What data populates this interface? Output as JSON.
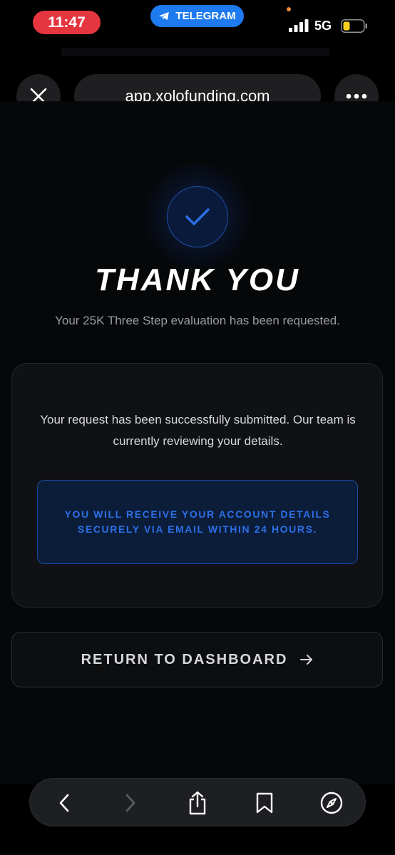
{
  "status_bar": {
    "time": "11:47",
    "back_app": "TELEGRAM",
    "network": "5G",
    "accent_time": "#e5353f",
    "accent_telegram": "#1e7bef",
    "icons": [
      "telegram-icon",
      "signal-icon",
      "battery-icon"
    ]
  },
  "browser": {
    "url": "app.xolofunding.com",
    "icons": [
      "close-icon",
      "more-icon"
    ]
  },
  "page": {
    "title": "THANK YOU",
    "subtitle": "Your 25K Three Step evaluation has been requested.",
    "card_text": "Your request has been successfully submitted. Our team is currently reviewing your details.",
    "notice": "YOU WILL RECEIVE YOUR ACCOUNT DETAILS SECURELY VIA EMAIL WITHIN 24 HOURS.",
    "dashboard_button": "RETURN TO DASHBOARD",
    "accent": "#2c6fe6",
    "icons": [
      "checkmark-icon",
      "arrow-right-icon"
    ]
  },
  "toolbar": {
    "icons": [
      "back-icon",
      "forward-icon",
      "share-icon",
      "bookmarks-icon",
      "compass-icon"
    ]
  }
}
